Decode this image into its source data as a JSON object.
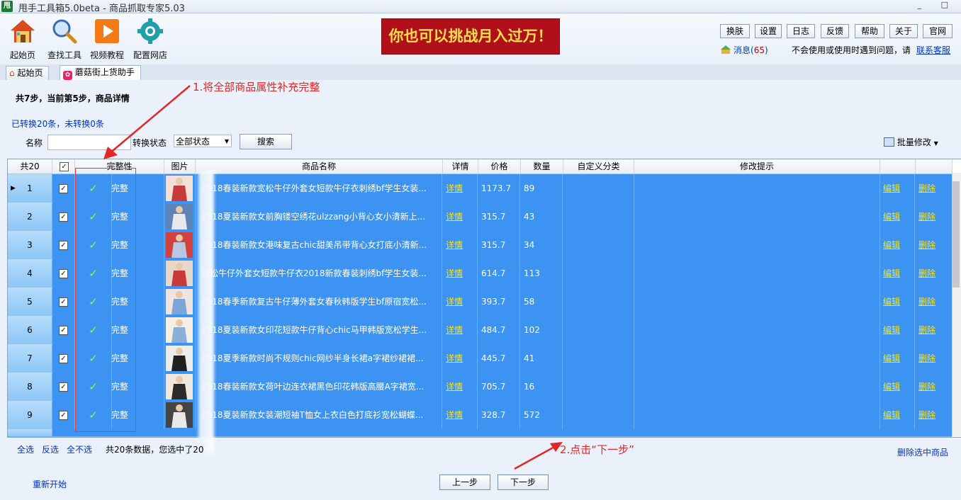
{
  "window": {
    "app_icon_text": "甩",
    "title": "甩手工具箱5.0beta - 商品抓取专家5.03",
    "controls": "_ □"
  },
  "toolbar": {
    "tools": [
      {
        "label": "起始页",
        "icon": "home-icon"
      },
      {
        "label": "查找工具",
        "icon": "search-icon"
      },
      {
        "label": "视频教程",
        "icon": "play-icon"
      },
      {
        "label": "配置网店",
        "icon": "gear-icon"
      }
    ],
    "banner": "你也可以挑战月入过万！",
    "top_buttons": [
      "换肤",
      "设置",
      "日志",
      "反馈",
      "帮助",
      "关于",
      "官网"
    ],
    "message_label": "消息(",
    "message_count": "65",
    "message_close": ")",
    "help_text": "不会使用或使用时遇到问题，请",
    "help_link": "联系客服"
  },
  "tabs": [
    {
      "label": "起始页",
      "icon": "home-icon"
    },
    {
      "label": "蘑菇街上货助手",
      "icon": "mogujie-icon"
    }
  ],
  "page": {
    "step_title": "共7步，当前第5步，商品详情",
    "convert_info": "已转换20条，未转换0条",
    "name_label": "名称",
    "name_value": "",
    "state_label": "转换状态",
    "state_value": "全部状态",
    "search_button": "搜索",
    "batch_edit": "批量修改"
  },
  "grid": {
    "columns": [
      "共20",
      "",
      "完整性",
      "图片",
      "商品名称",
      "详情",
      "价格",
      "数量",
      "自定义分类",
      "修改提示",
      "",
      ""
    ],
    "rows": [
      {
        "num": "1",
        "status": "完整",
        "name": "2018春装新款宽松牛仔外套女短款牛仔衣刺绣bf学生女装...",
        "detail": "详情",
        "price": "1173.7",
        "qty": "89",
        "edit": "编辑",
        "del": "删除"
      },
      {
        "num": "2",
        "status": "完整",
        "name": "2018夏装新款女前胸镂空绣花ulzzang小背心女小清新上...",
        "detail": "详情",
        "price": "315.7",
        "qty": "43",
        "edit": "编辑",
        "del": "删除"
      },
      {
        "num": "3",
        "status": "完整",
        "name": "2018春装新款女港味复古chic甜美吊带背心女打底小清新...",
        "detail": "详情",
        "price": "315.7",
        "qty": "34",
        "edit": "编辑",
        "del": "删除"
      },
      {
        "num": "4",
        "status": "完整",
        "name": "宽松牛仔外套女短款牛仔衣2018新款春装刺绣bf学生女装...",
        "detail": "详情",
        "price": "614.7",
        "qty": "113",
        "edit": "编辑",
        "del": "删除"
      },
      {
        "num": "5",
        "status": "完整",
        "name": "2018春季新款复古牛仔薄外套女春秋韩版学生bf原宿宽松...",
        "detail": "详情",
        "price": "393.7",
        "qty": "58",
        "edit": "编辑",
        "del": "删除"
      },
      {
        "num": "6",
        "status": "完整",
        "name": "2018夏装新款女印花短款牛仔背心chic马甲韩版宽松学生...",
        "detail": "详情",
        "price": "484.7",
        "qty": "102",
        "edit": "编辑",
        "del": "删除"
      },
      {
        "num": "7",
        "status": "完整",
        "name": "2018夏季新款时尚不规则chic网纱半身长裙a字裙纱裙裙...",
        "detail": "详情",
        "price": "445.7",
        "qty": "41",
        "edit": "编辑",
        "del": "删除"
      },
      {
        "num": "8",
        "status": "完整",
        "name": "2018春装新款女荷叶边连衣裙黑色印花韩版高腰A字裙宽...",
        "detail": "详情",
        "price": "705.7",
        "qty": "16",
        "edit": "编辑",
        "del": "删除"
      },
      {
        "num": "9",
        "status": "完整",
        "name": "2018夏装新款女装潮短袖T恤女上衣白色打底衫宽松蝴蝶...",
        "detail": "详情",
        "price": "328.7",
        "qty": "572",
        "edit": "编辑",
        "del": "删除"
      }
    ]
  },
  "bottom": {
    "select_all": "全选",
    "invert": "反选",
    "select_none": "全不选",
    "summary": "共20条数据，您选中了20",
    "delete_selected": "删除选中商品",
    "restart": "重新开始",
    "prev": "上一步",
    "next": "下一步"
  },
  "annotations": {
    "note1": "1.将全部商品属性补充完整",
    "note2": "2.点击“下一步”"
  },
  "colors": {
    "row_bg": "#3d93f1",
    "link_yellow": "#ffe400",
    "annotation_red": "#e52626"
  }
}
